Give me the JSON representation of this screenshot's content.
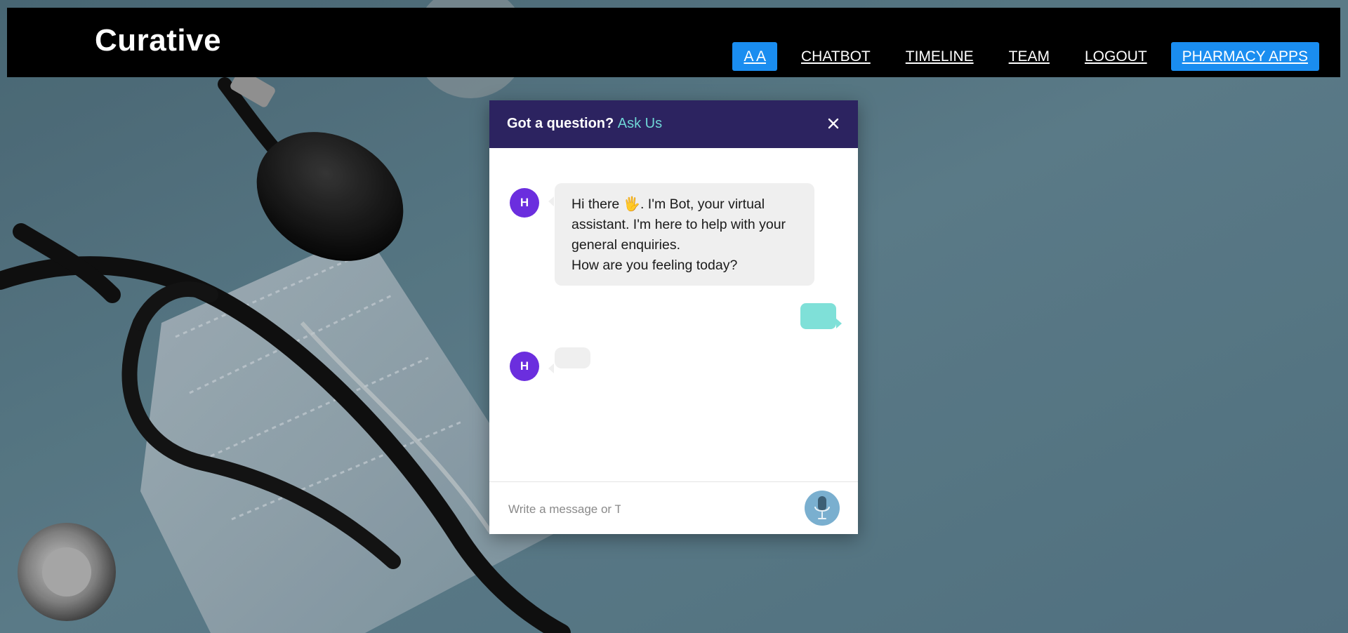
{
  "header": {
    "brand": "Curative",
    "nav": {
      "aa": "A A",
      "chatbot": "CHATBOT",
      "timeline": "TIMELINE",
      "team": "TEAM",
      "logout": "LOGOUT",
      "pharmacy": "PHARMACY APPS"
    }
  },
  "chat": {
    "title_prefix": "Got a question?",
    "title_link": "Ask Us",
    "close_icon": "close-icon",
    "messages": [
      {
        "sender": "bot",
        "avatar_initial": "H",
        "lines": [
          "Hi there 🖐. I'm Bot, your virtual assistant. I'm here to help with your general enquiries.",
          "How are you feeling today?"
        ]
      },
      {
        "sender": "user",
        "text": ""
      },
      {
        "sender": "bot",
        "avatar_initial": "H",
        "text": ""
      }
    ],
    "input_placeholder": "Write a message or Ta",
    "mic_icon": "microphone-icon"
  },
  "colors": {
    "header_bg": "#000000",
    "nav_button": "#1a8df0",
    "chat_header": "#2c2360",
    "ask_us": "#6fd6d6",
    "avatar": "#6b2ede",
    "bot_bubble": "#efefef",
    "user_bubble": "#7fe0d8",
    "mic": "#7aafcf"
  }
}
